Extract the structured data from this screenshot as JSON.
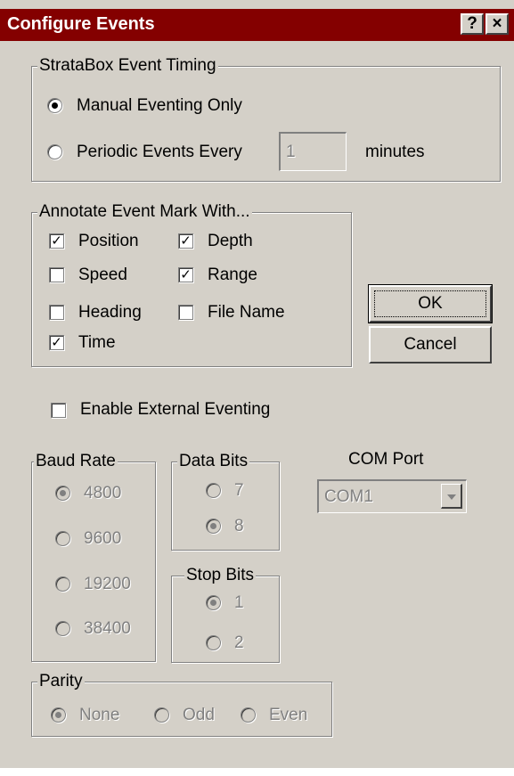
{
  "window": {
    "title": "Configure Events",
    "help_label": "?",
    "close_label": "×"
  },
  "timing": {
    "legend": "StrataBox Event Timing",
    "manual_label": "Manual Eventing Only",
    "periodic_label": "Periodic Events Every",
    "periodic_value": "1",
    "minutes_label": "minutes",
    "selected": "manual"
  },
  "annotate": {
    "legend": "Annotate Event Mark With...",
    "items": [
      {
        "label": "Position",
        "checked": true
      },
      {
        "label": "Depth",
        "checked": true
      },
      {
        "label": "Speed",
        "checked": false
      },
      {
        "label": "Range",
        "checked": true
      },
      {
        "label": "Heading",
        "checked": false
      },
      {
        "label": "File Name",
        "checked": false
      },
      {
        "label": "Time",
        "checked": true
      }
    ]
  },
  "buttons": {
    "ok": "OK",
    "cancel": "Cancel"
  },
  "external": {
    "label": "Enable External Eventing",
    "checked": false
  },
  "baud": {
    "legend": "Baud Rate",
    "options": [
      "4800",
      "9600",
      "19200",
      "38400"
    ],
    "selected": "4800"
  },
  "databits": {
    "legend": "Data Bits",
    "options": [
      "7",
      "8"
    ],
    "selected": "8"
  },
  "stopbits": {
    "legend": "Stop Bits",
    "options": [
      "1",
      "2"
    ],
    "selected": "1"
  },
  "comport": {
    "label": "COM Port",
    "value": "COM1"
  },
  "parity": {
    "legend": "Parity",
    "options": [
      "None",
      "Odd",
      "Even"
    ],
    "selected": "None"
  },
  "colors": {
    "titlebar": "#840000",
    "face": "#d4d0c8",
    "disabled_text": "#808080"
  }
}
